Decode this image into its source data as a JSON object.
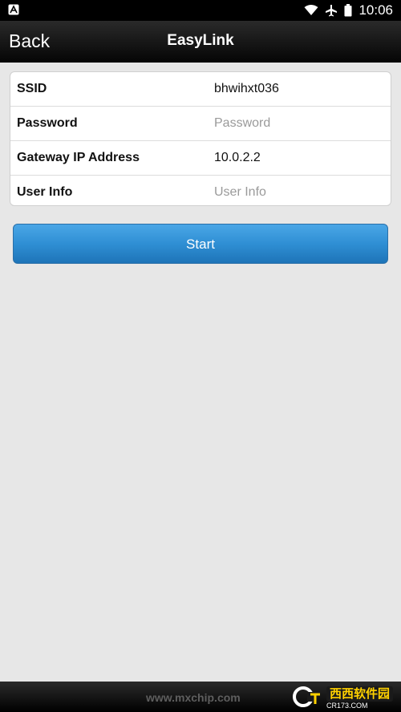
{
  "status_bar": {
    "time": "10:06",
    "left_icon": "notification-a-icon",
    "right_icons": [
      "wifi-icon",
      "airplane-icon",
      "battery-icon"
    ]
  },
  "nav": {
    "back_label": "Back",
    "title": "EasyLink"
  },
  "form": {
    "rows": [
      {
        "label": "SSID",
        "value": "bhwihxt036"
      },
      {
        "label": "Password",
        "value": "",
        "placeholder": "Password"
      },
      {
        "label": "Gateway IP Address",
        "value": "10.0.2.2"
      },
      {
        "label": "User Info",
        "value": "",
        "placeholder": "User Info"
      }
    ]
  },
  "start_label": "Start",
  "footer": {
    "text": "www.mxchip.com",
    "watermark_text": "西西软件园",
    "watermark_sub": "CR173.COM"
  },
  "colors": {
    "accent": "#2f8fd4",
    "navbar": "#111111",
    "background": "#e7e7e7"
  }
}
